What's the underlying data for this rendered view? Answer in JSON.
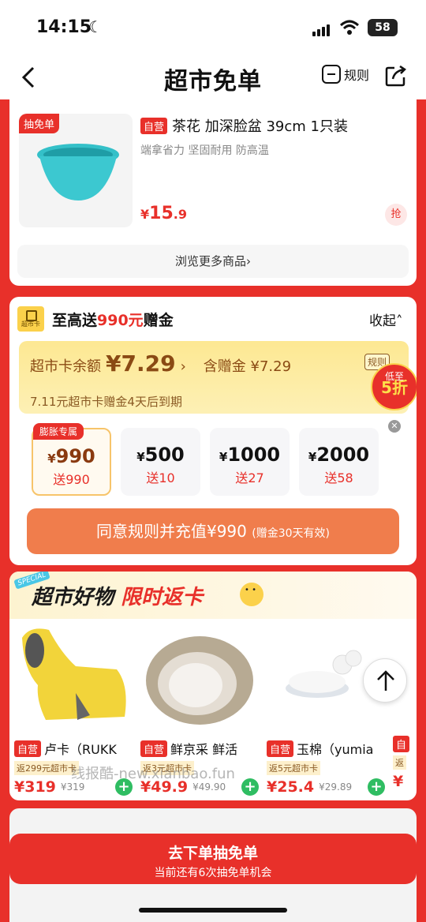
{
  "status": {
    "time": "14:15",
    "battery": "58"
  },
  "nav": {
    "title": "超市免单",
    "rules_label": "规则"
  },
  "product": {
    "badge": "抽免单",
    "tag": "自营",
    "title": "茶花 加深脸盆 39cm 1只装",
    "subtitle": "端拿省力 坚固耐用 防高温",
    "price_symbol": "¥",
    "price_int": "15",
    "price_dec": ".9",
    "grab_label": "抢",
    "browse_label": "浏览更多商品›"
  },
  "recharge": {
    "icon_label": "超市卡",
    "title_prefix": "至高送",
    "title_highlight": "990元",
    "title_suffix": "赠金",
    "collapse_label": "收起˄",
    "balance_label": "超市卡余额",
    "balance_value": "¥7.29",
    "balance_arrow": "›",
    "gift_label": "含赠金 ¥7.29",
    "rule_tag": "规则",
    "expire_note": "7.11元超市卡赠金4天后到期",
    "discount_top": "低至",
    "discount_num": "5折",
    "amounts": [
      {
        "tag": "膨胀专属",
        "cny": "¥",
        "value": "990",
        "gift": "送990"
      },
      {
        "tag": "",
        "cny": "¥",
        "value": "500",
        "gift": "送10"
      },
      {
        "tag": "",
        "cny": "¥",
        "value": "1000",
        "gift": "送27"
      },
      {
        "tag": "",
        "cny": "¥",
        "value": "2000",
        "gift": "送58"
      }
    ],
    "button_main": "同意规则并充值¥990",
    "button_sub": "(赠金30天有效)"
  },
  "goods_section": {
    "special": "SPECIAL",
    "title_black": "超市好物",
    "title_red": "限时返卡",
    "items": [
      {
        "tag": "自营",
        "name": "卢卡（RUKK",
        "rebate": "返299元超市卡",
        "price": "¥319",
        "orig": "¥319"
      },
      {
        "tag": "自营",
        "name": "鲜京采 鲜活",
        "rebate": "返3元超市卡",
        "price": "¥49.9",
        "orig": "¥49.90"
      },
      {
        "tag": "自营",
        "name": "玉棉（yumia",
        "rebate": "返5元超市卡",
        "price": "¥25.4",
        "orig": "¥29.89"
      },
      {
        "tag": "自",
        "name": "",
        "rebate": "返",
        "price": "¥",
        "orig": ""
      }
    ]
  },
  "watermark": "线报酷-new.xianbao.fun",
  "bottom": {
    "button_title": "去下单抽免单",
    "button_sub": "当前还有6次抽免单机会"
  }
}
